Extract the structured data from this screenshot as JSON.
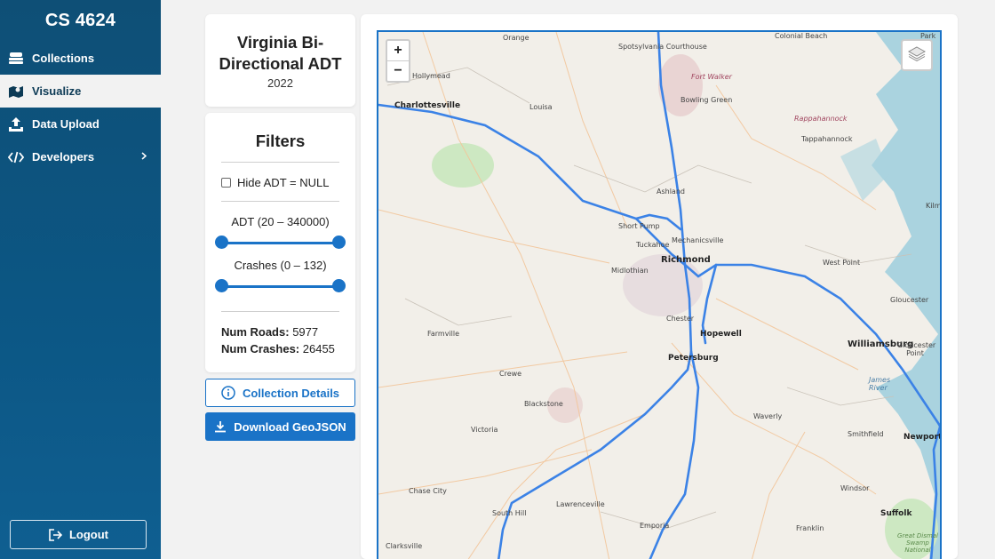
{
  "sidebar": {
    "brand": "CS 4624",
    "items": [
      {
        "label": "Collections",
        "icon": "layers-stack-icon"
      },
      {
        "label": "Visualize",
        "icon": "map-icon",
        "active": true
      },
      {
        "label": "Data Upload",
        "icon": "upload-icon"
      },
      {
        "label": "Developers",
        "icon": "code-icon",
        "has_submenu": true
      }
    ],
    "logout_label": "Logout"
  },
  "dataset": {
    "title": "Virginia Bi-Directional ADT",
    "year": "2022"
  },
  "filters": {
    "heading": "Filters",
    "hide_null_label": "Hide ADT = NULL",
    "hide_null_checked": false,
    "adt_label": "ADT (20 – 340000)",
    "adt_range": [
      20,
      340000
    ],
    "crashes_label": "Crashes (0 – 132)",
    "crashes_range": [
      0,
      132
    ],
    "num_roads_label": "Num Roads:",
    "num_roads": "5977",
    "num_crashes_label": "Num Crashes:",
    "num_crashes": "26455"
  },
  "buttons": {
    "details_label": "Collection Details",
    "download_label": "Download GeoJSON"
  },
  "map": {
    "zoom_in": "+",
    "zoom_out": "−",
    "road_color": "#3b82e6",
    "places": [
      {
        "name": "Orange"
      },
      {
        "name": "Spotsylvania Courthouse"
      },
      {
        "name": "Colonial Beach"
      },
      {
        "name": "Park"
      },
      {
        "name": "Hollymead"
      },
      {
        "name": "Fort Walker"
      },
      {
        "name": "Bowling Green"
      },
      {
        "name": "Charlottesville"
      },
      {
        "name": "Louisa"
      },
      {
        "name": "Rappahannock"
      },
      {
        "name": "Tappahannock"
      },
      {
        "name": "Ashland"
      },
      {
        "name": "Kilma"
      },
      {
        "name": "Short Pump"
      },
      {
        "name": "Mechanicsville"
      },
      {
        "name": "Tuckahoe"
      },
      {
        "name": "Richmond"
      },
      {
        "name": "West Point"
      },
      {
        "name": "Midlothian"
      },
      {
        "name": "Gloucester"
      },
      {
        "name": "Chester"
      },
      {
        "name": "Farmville"
      },
      {
        "name": "Hopewell"
      },
      {
        "name": "Williamsburg"
      },
      {
        "name": "Gloucester Point"
      },
      {
        "name": "Petersburg"
      },
      {
        "name": "Crewe"
      },
      {
        "name": "James River"
      },
      {
        "name": "Blackstone"
      },
      {
        "name": "Waverly"
      },
      {
        "name": "Victoria"
      },
      {
        "name": "Smithfield"
      },
      {
        "name": "Newport"
      },
      {
        "name": "Chase City"
      },
      {
        "name": "Windsor"
      },
      {
        "name": "South Hill"
      },
      {
        "name": "Lawrenceville"
      },
      {
        "name": "Suffolk"
      },
      {
        "name": "Emporia"
      },
      {
        "name": "Franklin"
      },
      {
        "name": "Clarksville"
      },
      {
        "name": "Great Dismal Swamp National"
      }
    ]
  }
}
